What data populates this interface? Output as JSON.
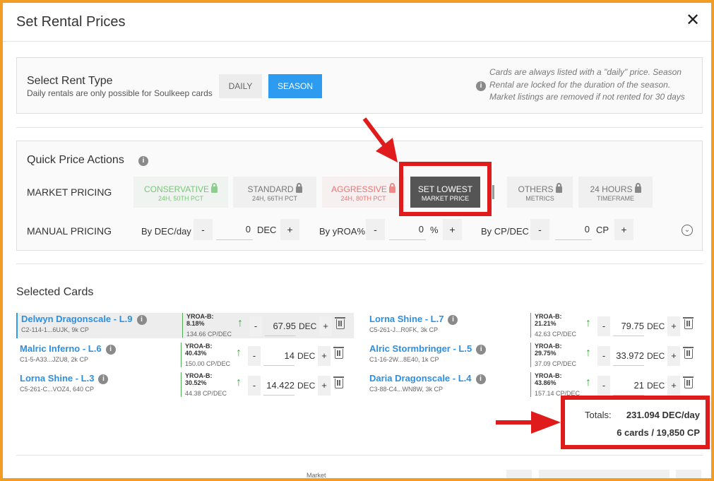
{
  "modal": {
    "title": "Set Rental Prices",
    "close": "✕"
  },
  "rent_type": {
    "title": "Select Rent Type",
    "subtitle": "Daily rentals are only possible for Soulkeep cards",
    "daily_label": "DAILY",
    "season_label": "SEASON",
    "note": "Cards are always listed with a \"daily\" price. Season Rental are locked for the duration of the season. Market listings are removed if not rented for 30 days"
  },
  "quick": {
    "title": "Quick Price Actions",
    "market_label": "MARKET PRICING",
    "manual_label": "MANUAL PRICING",
    "buttons": [
      {
        "l1": "CONSERVATIVE",
        "l2": "24H, 50TH PCT"
      },
      {
        "l1": "STANDARD",
        "l2": "24H, 66TH PCT"
      },
      {
        "l1": "AGGRESSIVE",
        "l2": "24H, 80TH PCT"
      },
      {
        "l1": "SET LOWEST",
        "l2": "MARKET PRICE"
      },
      {
        "l1": "OTHERS",
        "l2": "METRICS"
      },
      {
        "l1": "24 HOURS",
        "l2": "TIMEFRAME"
      }
    ],
    "manual": [
      {
        "label": "By DEC/day",
        "value": "0",
        "unit": "DEC"
      },
      {
        "label": "By yROA%",
        "value": "0",
        "unit": "%"
      },
      {
        "label": "By CP/DEC",
        "value": "0",
        "unit": "CP"
      }
    ]
  },
  "selected": {
    "title": "Selected Cards",
    "cards": [
      {
        "name": "Delwyn Dragonscale - L.9",
        "meta": "C2-114-1...6UJK, 9k CP",
        "yroa": "YROA-B: 8.18%",
        "cpdec": "134.66 CP/DEC",
        "value": "67.95",
        "unit": "DEC"
      },
      {
        "name": "Lorna Shine - L.7",
        "meta": "C5-261-J...R0FK, 3k CP",
        "yroa": "YROA-B: 21.21%",
        "cpdec": "42.63 CP/DEC",
        "value": "79.75",
        "unit": "DEC"
      },
      {
        "name": "Malric Inferno - L.6",
        "meta": "C1-5-A33...JZU8, 2k CP",
        "yroa": "YROA-B: 40.43%",
        "cpdec": "150.00 CP/DEC",
        "value": "14",
        "unit": "DEC"
      },
      {
        "name": "Alric Stormbringer - L.5",
        "meta": "C1-16-2W...8E40, 1k CP",
        "yroa": "YROA-B: 29.75%",
        "cpdec": "37.09 CP/DEC",
        "value": "33.972",
        "unit": "DEC"
      },
      {
        "name": "Lorna Shine - L.3",
        "meta": "C5-261-C...VOZ4, 640 CP",
        "yroa": "YROA-B: 30.52%",
        "cpdec": "44.38 CP/DEC",
        "value": "14.422",
        "unit": "DEC"
      },
      {
        "name": "Daria Dragonscale - L.4",
        "meta": "C3-88-C4...WN8W, 3k CP",
        "yroa": "YROA-B: 43.86%",
        "cpdec": "157.14 CP/DEC",
        "value": "21",
        "unit": "DEC"
      }
    ]
  },
  "totals": {
    "label": "Totals:",
    "value": "231.094 DEC/day",
    "cards": "6 cards / 19,850 CP"
  },
  "footer": {
    "market_label": "Market"
  },
  "colors": {
    "accent": "#2d9cf0",
    "highlight_red": "#e01b1b",
    "frame": "#f39c23"
  }
}
